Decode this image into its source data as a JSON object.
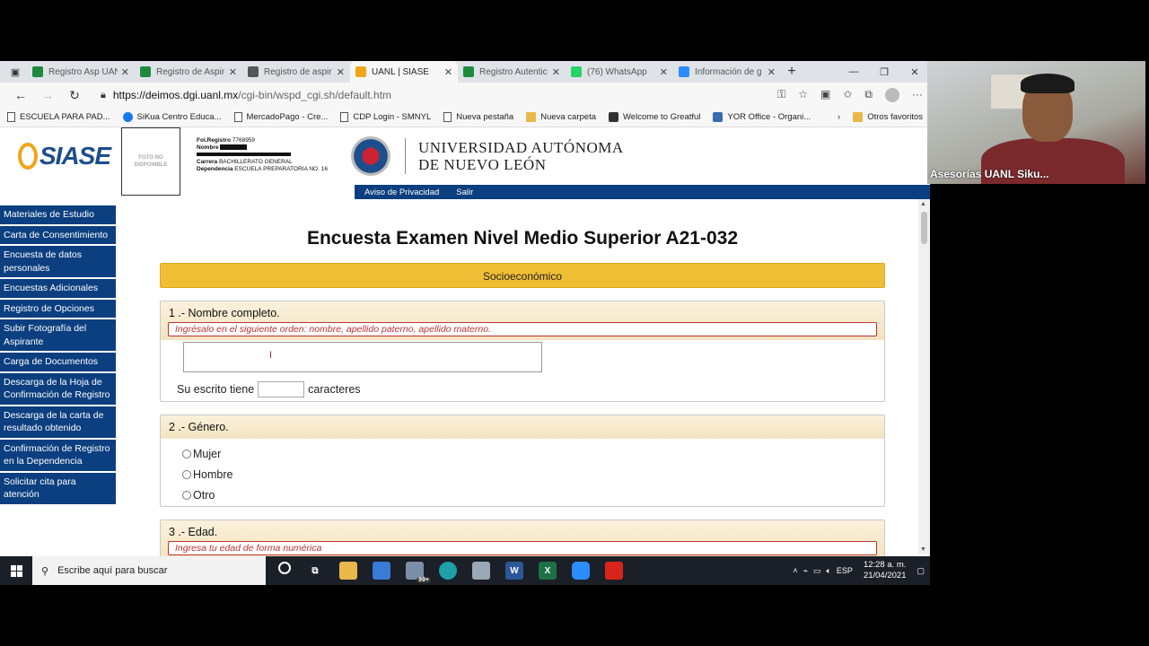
{
  "browser": {
    "tabs": [
      {
        "label": "Registro Asp UAN",
        "color": "#1e8a3e",
        "active": false
      },
      {
        "label": "Registro de Aspir",
        "color": "#1e8a3e",
        "active": false
      },
      {
        "label": "Registro de aspir",
        "color": "#555555",
        "active": false
      },
      {
        "label": "UANL | SIASE",
        "color": "#f2a41b",
        "active": true
      },
      {
        "label": "Registro Autentic",
        "color": "#1e8a3e",
        "active": false
      },
      {
        "label": "(76) WhatsApp",
        "color": "#25d366",
        "active": false
      },
      {
        "label": "Información de g",
        "color": "#2d8cff",
        "active": false
      }
    ],
    "url_host": "https://deimos.dgi.uanl.mx",
    "url_path": "/cgi-bin/wspd_cgi.sh/default.htm",
    "bookmarks": [
      {
        "label": "ESCUELA PARA PAD...",
        "icon": "page"
      },
      {
        "label": "SiKua Centro Educa...",
        "icon": "fb"
      },
      {
        "label": "MercadoPago - Cre...",
        "icon": "page"
      },
      {
        "label": "CDP Login - SMNYL",
        "icon": "page"
      },
      {
        "label": "Nueva pestaña",
        "icon": "page"
      },
      {
        "label": "Nueva carpeta",
        "icon": "folder"
      },
      {
        "label": "Welcome to Greatful",
        "icon": "dark"
      },
      {
        "label": "YOR Office - Organi...",
        "icon": "blue"
      }
    ],
    "other_favorites": "Otros favoritos"
  },
  "siase": {
    "logo": "SIASE",
    "photo_placeholder": "FOTO NO DISPONIBLE",
    "fol_label": "Fol.Registro",
    "fol_value": "7768959",
    "nombre_label": "Nombre",
    "carrera_label": "Carrera",
    "carrera_value": "BACHILLERATO GENERAL",
    "dependencia_label": "Dependencia",
    "dependencia_value": "ESCUELA PREPARATORIA NO. 16",
    "university_line1": "UNIVERSIDAD AUTÓNOMA",
    "university_line2": "DE NUEVO LEÓN",
    "privacy_link": "Aviso de Privacidad",
    "logout_link": "Salir"
  },
  "sidebar": {
    "items": [
      {
        "label": "Materiales de Estudio"
      },
      {
        "label": "Carta de Consentimiento"
      },
      {
        "label": "Encuesta de datos personales"
      },
      {
        "label": "Encuestas Adicionales"
      },
      {
        "label": "Registro de Opciones"
      },
      {
        "label": "Subir Fotografía del Aspirante"
      },
      {
        "label": "Carga de Documentos"
      },
      {
        "label": "Descarga de la Hoja de Confirmación de Registro"
      },
      {
        "label": "Descarga de la carta de resultado obtenido"
      },
      {
        "label": "Confirmación de Registro en la Dependencia"
      },
      {
        "label": "Solicitar cita para atención"
      }
    ]
  },
  "form": {
    "title": "Encuesta Examen Nivel Medio Superior A21-032",
    "section": "Socioeconómico",
    "q1": {
      "label": "1 .- Nombre completo.",
      "hint": "Ingrésalo en el siguiente orden: nombre, apellido paterno, apellido materno.",
      "count_prefix": "Su escrito tiene",
      "count_suffix": "caracteres"
    },
    "q2": {
      "label": "2 .- Género.",
      "options": [
        "Mujer",
        "Hombre",
        "Otro"
      ]
    },
    "q3": {
      "label": "3 .- Edad.",
      "hint": "Ingresa tu edad de forma numérica"
    }
  },
  "taskbar": {
    "search_placeholder": "Escribe aquí para buscar",
    "badge": "99+",
    "lang": "ESP",
    "time": "12:28 a. m.",
    "date": "21/04/2021"
  },
  "webcam": {
    "name": "Asesorías UANL Siku..."
  }
}
